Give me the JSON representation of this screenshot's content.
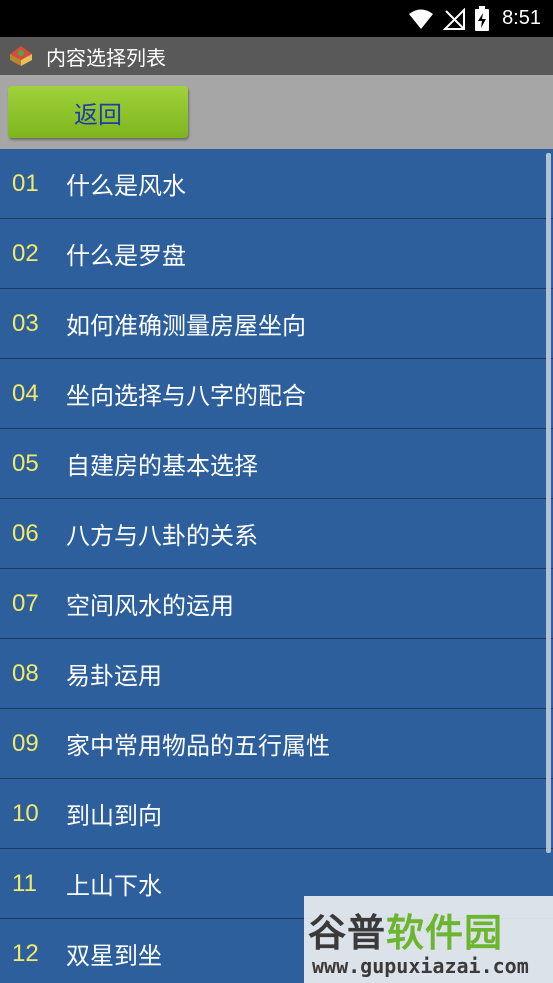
{
  "status_bar": {
    "time": "8:51"
  },
  "title_bar": {
    "title": "内容选择列表"
  },
  "toolbar": {
    "back_label": "返回"
  },
  "list": {
    "items": [
      {
        "num": "01",
        "label": "什么是风水"
      },
      {
        "num": "02",
        "label": "什么是罗盘"
      },
      {
        "num": "03",
        "label": "如何准确测量房屋坐向"
      },
      {
        "num": "04",
        "label": "坐向选择与八字的配合"
      },
      {
        "num": "05",
        "label": "自建房的基本选择"
      },
      {
        "num": "06",
        "label": "八方与八卦的关系"
      },
      {
        "num": "07",
        "label": "空间风水的运用"
      },
      {
        "num": "08",
        "label": "易卦运用"
      },
      {
        "num": "09",
        "label": "家中常用物品的五行属性"
      },
      {
        "num": "10",
        "label": "到山到向"
      },
      {
        "num": "11",
        "label": "上山下水"
      },
      {
        "num": "12",
        "label": "双星到坐"
      }
    ]
  },
  "watermark": {
    "logo_part1": "谷普",
    "logo_part2": "软件园",
    "url": "www.gupuxiazai.com"
  },
  "colors": {
    "list_bg": "#2d5f9c",
    "number": "#f2e96a",
    "button_bg": "#8cc63f",
    "button_text": "#1a3fa8",
    "title_bar_bg": "#595959",
    "toolbar_bg": "#a6a6a6"
  }
}
